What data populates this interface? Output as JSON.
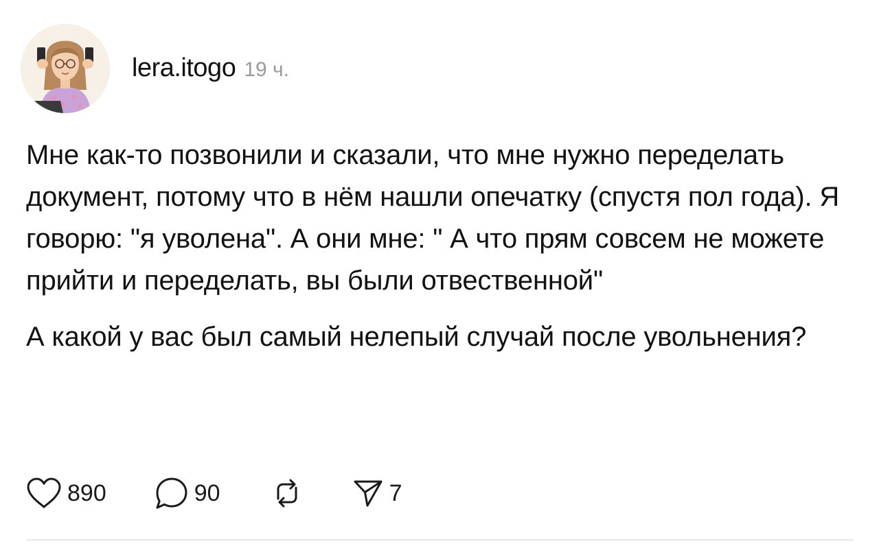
{
  "post": {
    "username": "lera.itogo",
    "timestamp": "19 ч.",
    "paragraphs": [
      "Мне как-то позвонили и сказали, что мне нужно переделать документ, потому что в нём нашли опечатку (спустя пол года). Я говорю: \"я уволена\". А они мне: \" А что прям совсем не можете прийти и переделать, вы были отвественной\"",
      "А какой у вас был самый нелепый случай после увольнения?"
    ],
    "actions": {
      "likes": "890",
      "replies": "90",
      "shares": "7"
    },
    "icons": {
      "like": "heart-icon",
      "reply": "comment-bubble-icon",
      "repost": "repost-icon",
      "share": "send-icon"
    }
  }
}
